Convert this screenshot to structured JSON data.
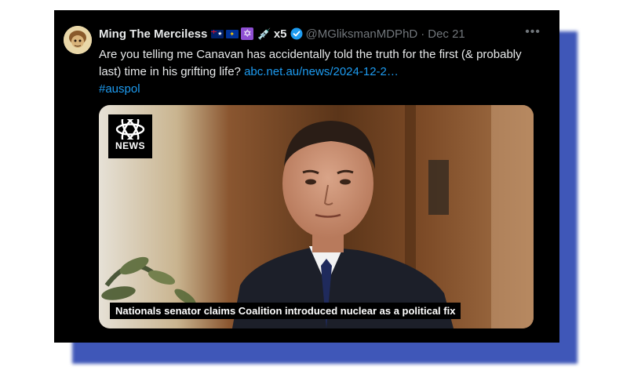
{
  "tweet": {
    "display_name": "Ming The Merciless",
    "emoji_suffix": "x5",
    "handle": "@MGliksmanMDPhD",
    "separator": "·",
    "date": "Dec 21",
    "more_label": "•••",
    "text_before_link": "Are you telling me Canavan has accidentally told the truth for the first (& probably last) time in his grifting life? ",
    "link": "abc.net.au/news/2024-12-2…",
    "hashtag": "#auspol"
  },
  "media": {
    "logo_word": "NEWS",
    "caption": "Nationals senator claims Coalition introduced nuclear as a political fix"
  },
  "colors": {
    "background": "#000000",
    "text": "#e7e9ea",
    "muted": "#71767b",
    "link": "#1d9bf0",
    "frame_shadow": "#3f57b8"
  },
  "icons": [
    "avatar",
    "australia-flag-icon",
    "eu-flag-icon",
    "star-of-david-icon",
    "syringe-icon",
    "verified-badge-icon",
    "more-icon",
    "abc-logo-icon"
  ]
}
